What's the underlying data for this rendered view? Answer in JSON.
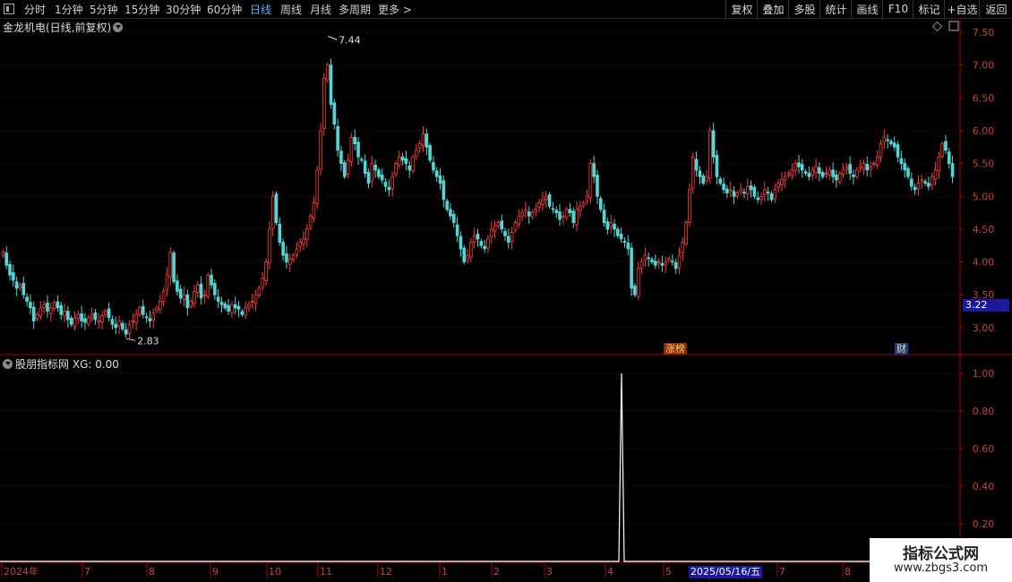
{
  "toolbar": {
    "periods": [
      {
        "label": "分时",
        "active": false
      },
      {
        "label": "1分钟",
        "active": false
      },
      {
        "label": "5分钟",
        "active": false
      },
      {
        "label": "15分钟",
        "active": false
      },
      {
        "label": "30分钟",
        "active": false
      },
      {
        "label": "60分钟",
        "active": false
      },
      {
        "label": "日线",
        "active": true
      },
      {
        "label": "周线",
        "active": false
      },
      {
        "label": "月线",
        "active": false
      },
      {
        "label": "多周期",
        "active": false
      },
      {
        "label": "更多",
        "active": false
      }
    ],
    "more_chevron": ">",
    "right_buttons": [
      "复权",
      "叠加",
      "多股",
      "统计",
      "画线",
      "F10",
      "标记",
      "+自选",
      "返回"
    ]
  },
  "main_chart": {
    "title": "金龙机电(日线,前复权)",
    "high_label": "7.44",
    "low_label": "2.83",
    "last_price_tag": "3.22",
    "marker_zhangbang": "涨榜",
    "marker_cai": "财",
    "colors": {
      "up": "#ff3a3a",
      "down": "#4fd8d8",
      "grid": "#7a0000",
      "axis": "#b00000"
    }
  },
  "indicator": {
    "title": "股朋指标网",
    "value_label": "XG: 0.00"
  },
  "time_axis": {
    "labels": [
      "2024年",
      "7",
      "8",
      "9",
      "10",
      "11",
      "12",
      "1",
      "2",
      "3",
      "4",
      "5",
      "7",
      "8"
    ],
    "cursor_date": "2025/05/16/五"
  },
  "watermark": {
    "title": "指标公式网",
    "url": "www.zbgs3.com"
  },
  "chart_data": [
    {
      "type": "candlestick",
      "title": "金龙机电(日线,前复权)",
      "ylim": [
        2.7,
        7.6
      ],
      "y_ticks": [
        "7.50",
        "7.00",
        "6.50",
        "6.00",
        "5.50",
        "5.00",
        "4.50",
        "4.00",
        "3.50",
        "3.00"
      ],
      "annotations": [
        {
          "label": "7.44",
          "value": 7.44
        },
        {
          "label": "2.83",
          "value": 2.83
        }
      ],
      "close": [
        4.15,
        3.95,
        3.8,
        3.72,
        3.6,
        3.65,
        3.5,
        3.4,
        3.3,
        3.1,
        3.2,
        3.3,
        3.35,
        3.25,
        3.3,
        3.38,
        3.3,
        3.2,
        3.25,
        3.12,
        3.05,
        3.15,
        3.2,
        3.1,
        3.08,
        3.15,
        3.2,
        3.12,
        3.1,
        3.18,
        3.25,
        3.15,
        3.05,
        3.0,
        3.1,
        2.98,
        2.9,
        3.05,
        3.1,
        3.2,
        3.3,
        3.2,
        3.15,
        3.1,
        3.22,
        3.3,
        3.4,
        3.55,
        3.8,
        4.15,
        3.7,
        3.55,
        3.45,
        3.5,
        3.3,
        3.4,
        3.55,
        3.65,
        3.45,
        3.5,
        3.8,
        3.65,
        3.5,
        3.4,
        3.35,
        3.3,
        3.25,
        3.35,
        3.3,
        3.28,
        3.2,
        3.3,
        3.35,
        3.4,
        3.5,
        3.6,
        3.75,
        4.0,
        4.5,
        5.0,
        4.6,
        4.3,
        4.1,
        4.0,
        4.05,
        4.1,
        4.2,
        4.3,
        4.35,
        4.5,
        4.7,
        4.9,
        5.4,
        6.0,
        6.8,
        7.0,
        6.4,
        6.1,
        5.7,
        5.5,
        5.3,
        5.55,
        5.9,
        5.8,
        5.6,
        5.55,
        5.35,
        5.2,
        5.5,
        5.4,
        5.3,
        5.25,
        5.15,
        5.1,
        5.3,
        5.5,
        5.6,
        5.55,
        5.5,
        5.4,
        5.6,
        5.7,
        5.8,
        5.95,
        5.75,
        5.55,
        5.4,
        5.3,
        5.2,
        4.95,
        4.8,
        4.7,
        4.6,
        4.4,
        4.2,
        4.0,
        4.1,
        4.3,
        4.4,
        4.35,
        4.25,
        4.2,
        4.35,
        4.5,
        4.55,
        4.6,
        4.5,
        4.4,
        4.3,
        4.45,
        4.6,
        4.7,
        4.75,
        4.8,
        4.7,
        4.75,
        4.8,
        4.9,
        4.95,
        5.0,
        4.85,
        4.8,
        4.75,
        4.65,
        4.7,
        4.8,
        4.75,
        4.6,
        4.8,
        4.85,
        4.9,
        5.0,
        5.5,
        5.3,
        5.0,
        4.8,
        4.6,
        4.5,
        4.6,
        4.5,
        4.4,
        4.35,
        4.3,
        4.2,
        3.6,
        3.5,
        3.9,
        4.0,
        4.1,
        4.05,
        4.0,
        3.95,
        4.0,
        3.95,
        4.0,
        4.05,
        4.0,
        3.9,
        4.1,
        4.3,
        4.6,
        5.1,
        5.6,
        5.4,
        5.3,
        5.2,
        5.3,
        6.0,
        5.6,
        5.3,
        5.2,
        5.1,
        5.05,
        5.1,
        5.0,
        5.05,
        5.1,
        5.05,
        5.15,
        5.1,
        5.0,
        4.95,
        5.0,
        5.1,
        5.05,
        4.95,
        5.1,
        5.2,
        5.25,
        5.3,
        5.35,
        5.4,
        5.5,
        5.45,
        5.4,
        5.35,
        5.3,
        5.4,
        5.45,
        5.35,
        5.3,
        5.35,
        5.4,
        5.3,
        5.25,
        5.35,
        5.4,
        5.45,
        5.35,
        5.3,
        5.4,
        5.45,
        5.5,
        5.4,
        5.45,
        5.5,
        5.6,
        5.8,
        5.9,
        5.85,
        5.8,
        5.75,
        5.6,
        5.5,
        5.4,
        5.3,
        5.15,
        5.1,
        5.2,
        5.25,
        5.2,
        5.15,
        5.3,
        5.4,
        5.6,
        5.8,
        5.7,
        5.5,
        5.3
      ]
    },
    {
      "type": "line",
      "series": [
        {
          "name": "XG",
          "values": [
            0,
            0.5,
            1.0,
            0.5,
            0
          ]
        }
      ],
      "ylim": [
        0,
        1.05
      ],
      "y_ticks": [
        "1.00",
        "0.80",
        "0.60",
        "0.40",
        "0.20"
      ],
      "note_shown": "XG: 0.00"
    }
  ]
}
